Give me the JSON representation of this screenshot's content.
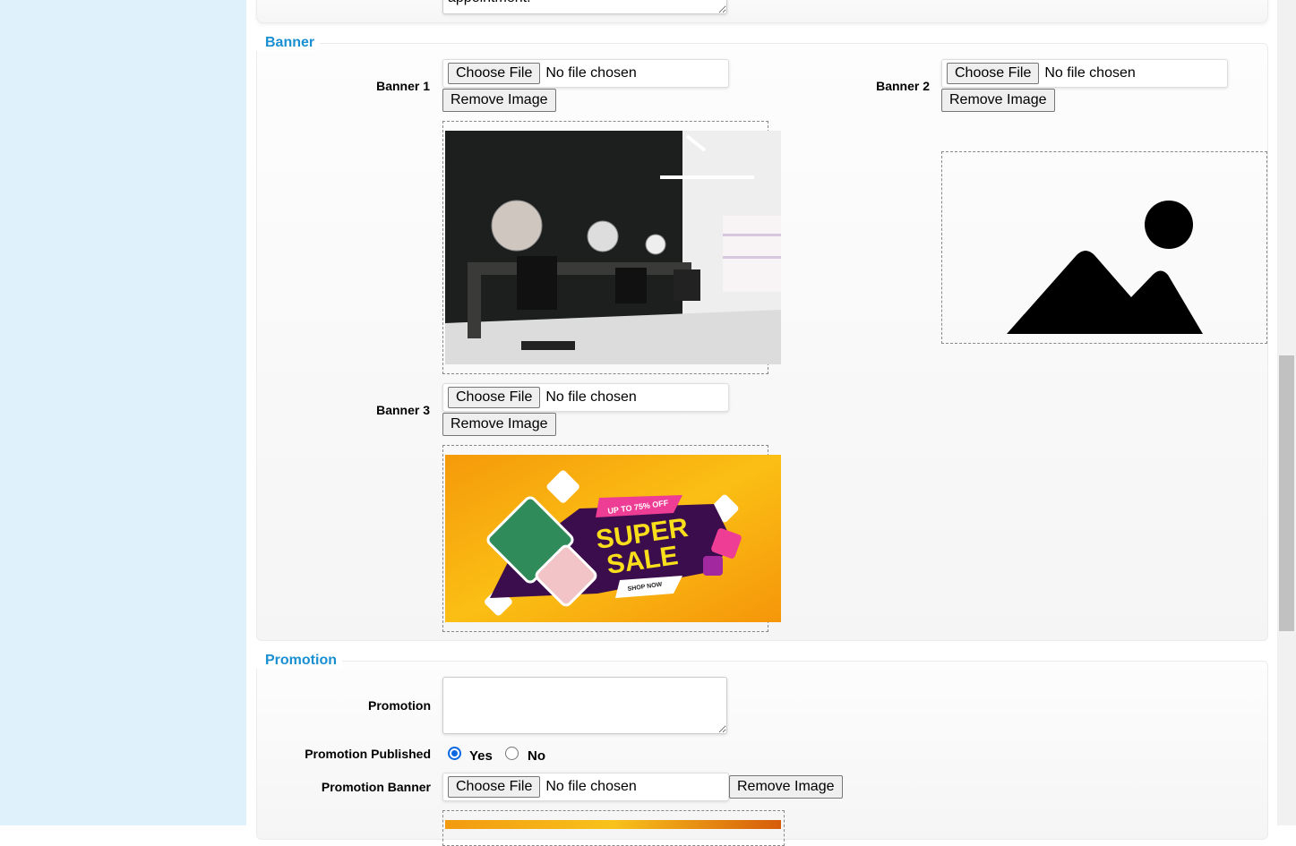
{
  "previous_field": {
    "textarea_value": "appointment."
  },
  "banner_section": {
    "legend": "Banner",
    "banners": [
      {
        "label": "Banner 1",
        "choose_label": "Choose File",
        "file_status": "No file chosen",
        "remove_label": "Remove Image",
        "image": "salon-interior-photo"
      },
      {
        "label": "Banner 2",
        "choose_label": "Choose File",
        "file_status": "No file chosen",
        "remove_label": "Remove Image",
        "image": "image-placeholder-icon"
      },
      {
        "label": "Banner 3",
        "choose_label": "Choose File",
        "file_status": "No file chosen",
        "remove_label": "Remove Image",
        "image": "super-sale-banner",
        "sale_top": "UP TO 75% OFF",
        "sale_line1": "SUPER",
        "sale_line2": "SALE",
        "sale_cta": "SHOP NOW"
      }
    ]
  },
  "promotion_section": {
    "legend": "Promotion",
    "promotion_label": "Promotion",
    "promotion_value": "",
    "published_label": "Promotion Published",
    "published_options": [
      {
        "label": "Yes",
        "checked": true
      },
      {
        "label": "No",
        "checked": false
      }
    ],
    "banner_label": "Promotion Banner",
    "choose_label": "Choose File",
    "file_status": "No file chosen",
    "remove_label": "Remove Image"
  },
  "colors": {
    "accent": "#1a8fd1",
    "sidebar": "#dff2fc",
    "radio": "#0a67e0"
  }
}
